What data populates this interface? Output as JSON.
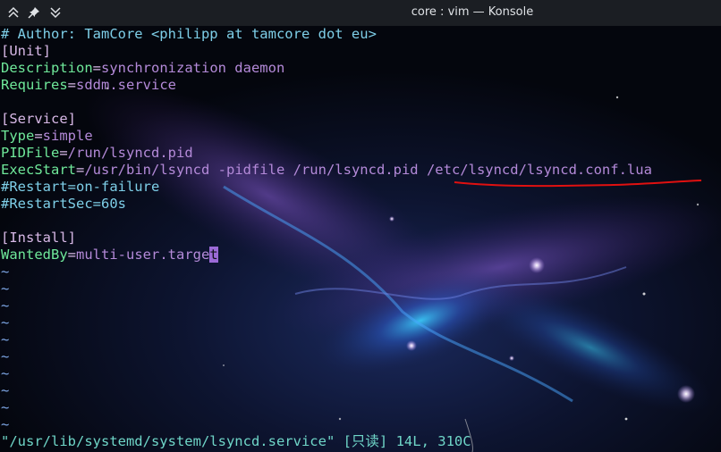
{
  "window": {
    "title": "core : vim — Konsole",
    "buttons": [
      {
        "icon": "keep-above-icon"
      },
      {
        "icon": "pin-icon"
      },
      {
        "icon": "minimize-chevron-icon"
      }
    ]
  },
  "editor": {
    "author_comment": "# Author: TamCore <philipp at tamcore dot eu>",
    "unit_header": "[Unit]",
    "description_key": "Description",
    "description_val": "synchronization daemon",
    "requires_key": "Requires",
    "requires_val": "sddm.service",
    "service_header": "[Service]",
    "type_key": "Type",
    "type_val": "simple",
    "pidfile_key": "PIDFile",
    "pidfile_val": "/run/lsyncd.pid",
    "execstart_key": "ExecStart",
    "execstart_val": "/usr/bin/lsyncd -pidfile /run/lsyncd.pid /etc/lsyncd/lsyncd.conf.lua",
    "restart_comment": "#Restart=on-failure",
    "restartsec_comment": "#RestartSec=60s",
    "install_header": "[Install]",
    "wantedby_key": "WantedBy",
    "wantedby_val": "multi-user.targe",
    "cursor_char": "t",
    "tilde": "~",
    "equals": "=",
    "status_line": "\"/usr/lib/systemd/system/lsyncd.service\" [只读] 14L, 310C"
  },
  "colors": {
    "titlebar": "#1b1e23",
    "comment": "#7ecfe8",
    "key": "#6fe89a",
    "value": "#b48ad9",
    "annotation": "#e01010"
  }
}
